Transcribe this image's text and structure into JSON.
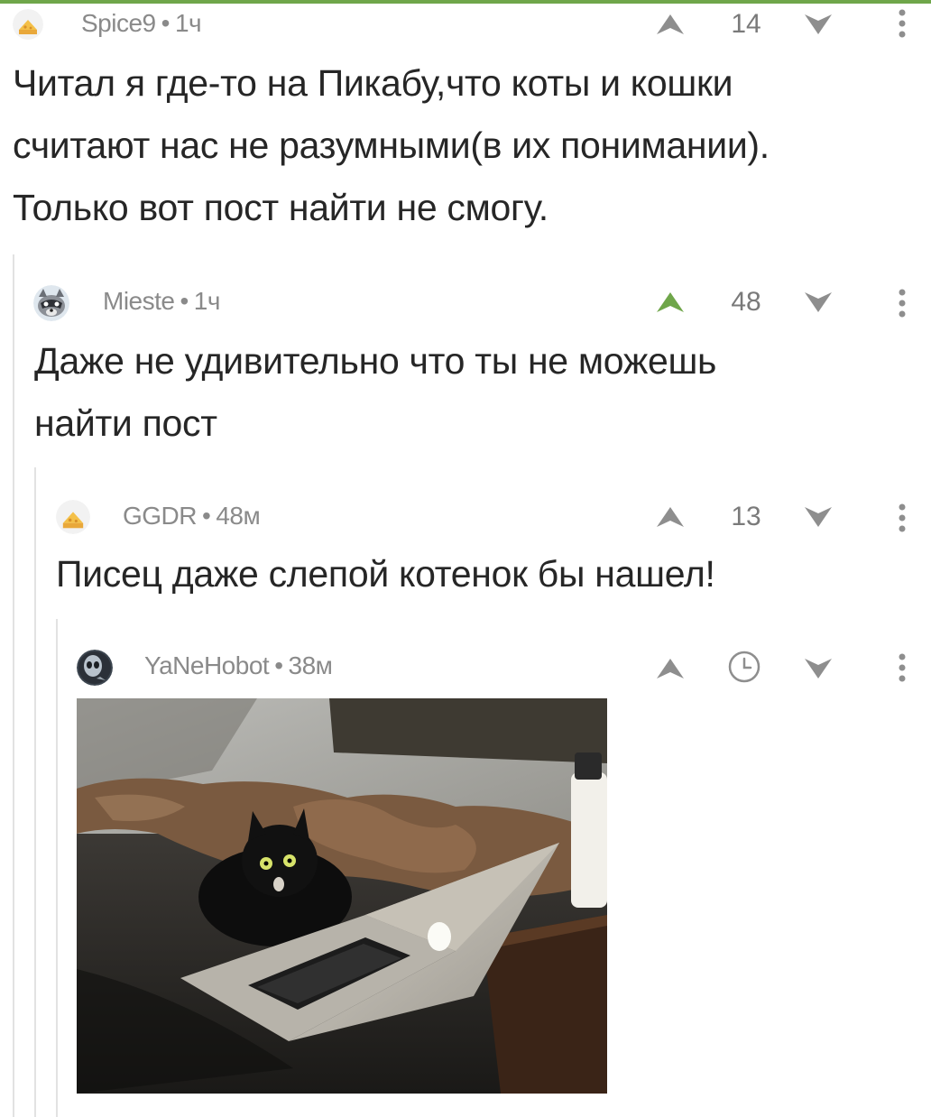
{
  "comments": [
    {
      "author": "Spice9",
      "time": "1ч",
      "score": "14",
      "text_lines": [
        "Читал я где-то на Пикабу,что коты и кошки",
        "считают нас не разумными(в их понимании).",
        "Только вот пост найти не смогу."
      ],
      "avatar_icon": "cheese-avatar-icon",
      "upvoted": false
    },
    {
      "author": "Mieste",
      "time": "1ч",
      "score": "48",
      "text_lines": [
        "Даже не удивительно что ты не можешь",
        "найти пост"
      ],
      "avatar_icon": "raccoon-avatar-icon",
      "upvoted": true
    },
    {
      "author": "GGDR",
      "time": "48м",
      "score": "13",
      "text_lines": [
        "Писец даже слепой котенок бы нашел!"
      ],
      "avatar_icon": "cheese-avatar-icon",
      "upvoted": false
    },
    {
      "author": "YaNeHobot",
      "time": "38м",
      "score_icon": "clock-icon",
      "avatar_icon": "alien-avatar-icon",
      "image_icon": "cat-with-laptop-photo",
      "upvoted": false
    }
  ],
  "separator": "•",
  "colors": {
    "accent_green": "#6fa64a",
    "vote_gray": "#8e8e8e",
    "meta_gray": "#8a8a8a",
    "thread_line": "#e2e2e2"
  }
}
